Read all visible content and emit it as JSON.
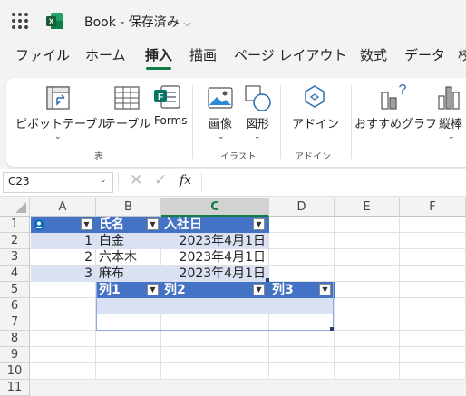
{
  "app": {
    "title": "Book - 保存済み",
    "title_chevron": "⌵"
  },
  "tabs": [
    {
      "label": "ファイル",
      "active": false
    },
    {
      "label": "ホーム",
      "active": false
    },
    {
      "label": "挿入",
      "active": true
    },
    {
      "label": "描画",
      "active": false
    },
    {
      "label": "ページ レイアウト",
      "active": false
    },
    {
      "label": "数式",
      "active": false
    },
    {
      "label": "データ",
      "active": false
    },
    {
      "label": "校",
      "active": false
    }
  ],
  "ribbon": {
    "pivot_label": "ピボットテーブル",
    "table_label": "テーブル",
    "forms_label": "Forms",
    "group_table": "表",
    "image_label": "画像",
    "shape_label": "図形",
    "group_illust": "イラスト",
    "addin_label": "アドイン",
    "group_addin": "アドイン",
    "reco_label": "おすすめグラフ",
    "vbar_label": "縦棒",
    "chevron": "⌄"
  },
  "formula_bar": {
    "name_box": "C23",
    "fx": "fx",
    "value": ""
  },
  "columns": [
    "A",
    "B",
    "C",
    "D",
    "E",
    "F"
  ],
  "selected_column": "C",
  "rows": [
    "1",
    "2",
    "3",
    "4",
    "5",
    "6",
    "7",
    "8",
    "9",
    "10",
    "11"
  ],
  "table1": {
    "headers": [
      "",
      "氏名",
      "入社日"
    ],
    "rows": [
      {
        "no": "1",
        "name": "白金",
        "date": "2023年4月1日"
      },
      {
        "no": "2",
        "name": "六本木",
        "date": "2023年4月1日"
      },
      {
        "no": "3",
        "name": "麻布",
        "date": "2023年4月1日"
      }
    ]
  },
  "table2": {
    "headers": [
      "列1",
      "列2",
      "列3"
    ]
  },
  "colors": {
    "accent": "#107c41",
    "table_header": "#4472c4",
    "table_band": "#d9e1f2"
  }
}
